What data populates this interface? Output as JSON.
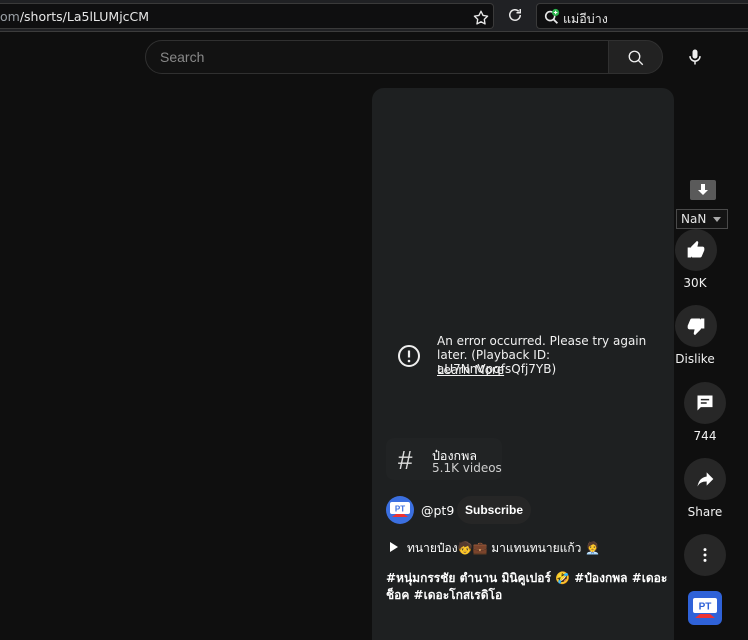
{
  "browser": {
    "url_prefix": "om",
    "url_path": "/shorts/La5lLUMjcCM",
    "side_search_text": "แม่อีบ่าง"
  },
  "header": {
    "search_placeholder": "Search"
  },
  "player": {
    "error_message": "An error occurred. Please try again later. (Playback ID: aU7NnVpqfsQfj7YB)",
    "learn_more": "Learn More"
  },
  "hashtag_chip": {
    "symbol": "#",
    "name": "ป๋องกพล",
    "count": "5.1K videos"
  },
  "channel": {
    "handle": "@pt9",
    "subscribe_label": "Subscribe",
    "avatar_text": "PT"
  },
  "sound": {
    "text": "ทนายป๋อง🧒💼 มาแทนทนายแก้ว 🧑‍💼"
  },
  "caption": {
    "text": "#หนุ่มกรรชัย ตำนาน มินิคูเปอร์ 🤣 #ป๋องกพล #เดอะช็อค #เดอะโกสเรดิโอ"
  },
  "actions": {
    "speed_value": "NaN",
    "like_count": "30K",
    "dislike_label": "Dislike",
    "comment_count": "744",
    "share_label": "Share"
  },
  "colors": {
    "background": "#0f0f0f",
    "player_bg": "#1e2021",
    "button_bg": "#272727",
    "avatar_blue": "#3b6fe0"
  }
}
